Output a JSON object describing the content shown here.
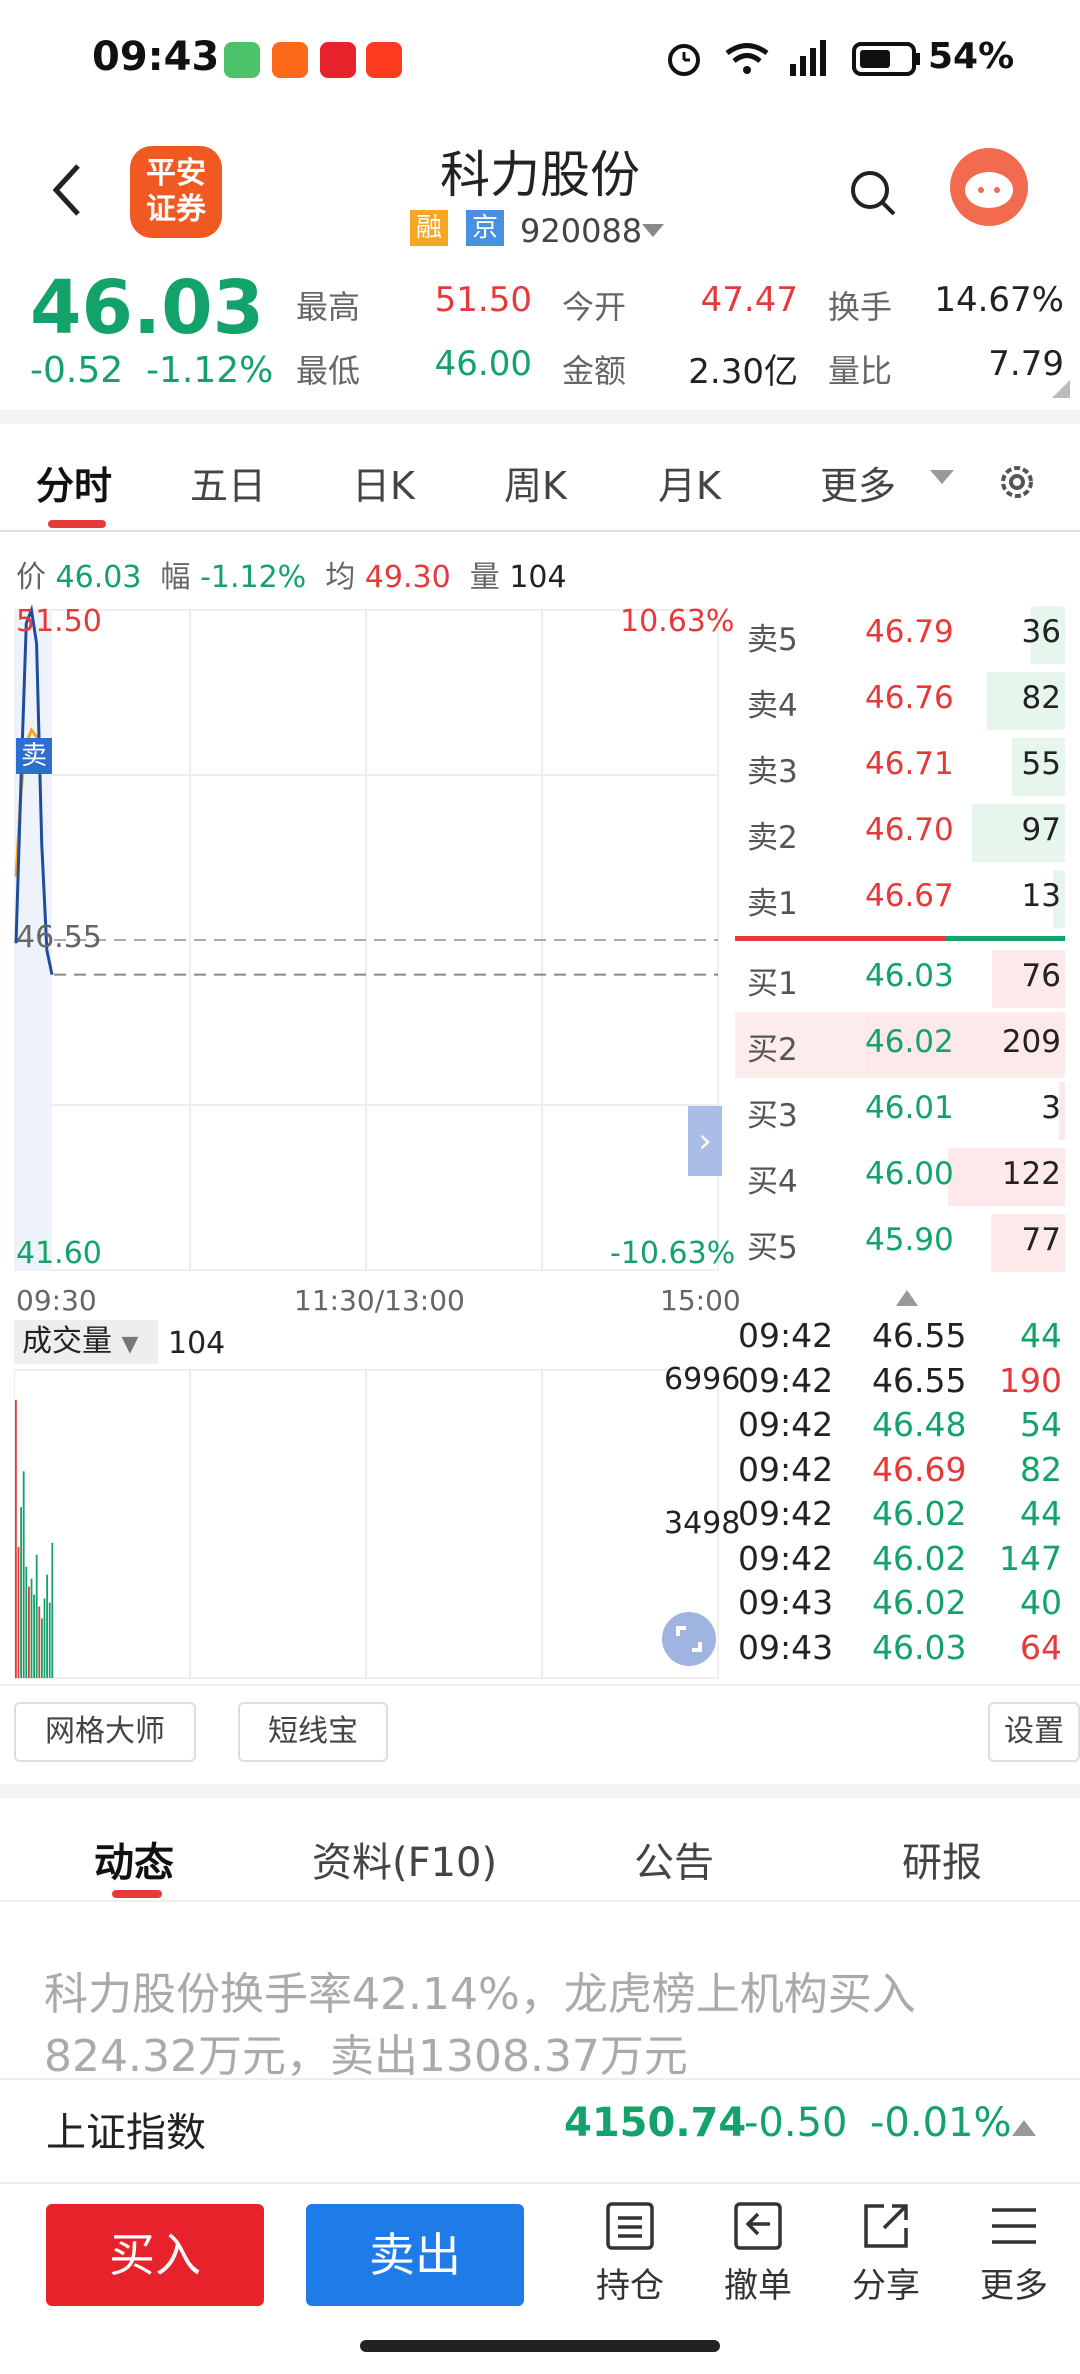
{
  "status_bar": {
    "time": "09:43",
    "battery": "54%"
  },
  "header": {
    "logo_line1": "平安",
    "logo_line2": "证券",
    "stock_name": "科力股份",
    "tag_margin": "融",
    "tag_exchange": "京",
    "stock_code": "920088"
  },
  "quote": {
    "price": "46.03",
    "change": "-0.52",
    "change_pct": "-1.12%",
    "high_label": "最高",
    "high": "51.50",
    "low_label": "最低",
    "low": "46.00",
    "open_label": "今开",
    "open": "47.47",
    "amount_label": "金额",
    "amount": "2.30亿",
    "turnover_label": "换手",
    "turnover": "14.67%",
    "volume_ratio_label": "量比",
    "volume_ratio": "7.79"
  },
  "tabs": [
    "分时",
    "五日",
    "日K",
    "周K",
    "月K",
    "更多"
  ],
  "info_row": {
    "price_label": "价",
    "price": "46.03",
    "range_label": "幅",
    "range": "-1.12%",
    "avg_label": "均",
    "avg": "49.30",
    "vol_label": "量",
    "vol": "104"
  },
  "chart_data": {
    "type": "line",
    "y_left_top": "51.50",
    "y_left_mid": "46.55",
    "y_left_bottom": "41.60",
    "y_right_top": "10.63%",
    "y_right_bottom": "-10.63%",
    "x_labels": [
      "09:30",
      "11:30/13:00",
      "15:00"
    ],
    "ylim": [
      41.6,
      51.5
    ],
    "prev_close": 46.55,
    "price_series": [
      46.5,
      49.0,
      51.3,
      51.5,
      51.0,
      48.0,
      46.4,
      46.03
    ],
    "avg_series": [
      47.5,
      48.8,
      49.5,
      49.7,
      49.6,
      49.4,
      49.3,
      49.3
    ],
    "marker": "卖",
    "volume_label": "成交量",
    "volume_value": "104",
    "volume_axis_top": "6996",
    "volume_axis_mid": "3498",
    "volume_ylim": [
      0,
      6996
    ],
    "volume_bars": [
      {
        "v": 6996,
        "c": "red"
      },
      {
        "v": 3300,
        "c": "red"
      },
      {
        "v": 4300,
        "c": "green"
      },
      {
        "v": 5200,
        "c": "green"
      },
      {
        "v": 2800,
        "c": "green"
      },
      {
        "v": 2300,
        "c": "red"
      },
      {
        "v": 2500,
        "c": "green"
      },
      {
        "v": 2100,
        "c": "green"
      },
      {
        "v": 3100,
        "c": "green"
      },
      {
        "v": 1800,
        "c": "red"
      },
      {
        "v": 1500,
        "c": "green"
      },
      {
        "v": 2000,
        "c": "green"
      },
      {
        "v": 2600,
        "c": "green"
      },
      {
        "v": 1900,
        "c": "green"
      },
      {
        "v": 3400,
        "c": "green"
      }
    ]
  },
  "orderbook": {
    "asks": [
      {
        "label": "卖5",
        "price": "46.79",
        "vol": "36"
      },
      {
        "label": "卖4",
        "price": "46.76",
        "vol": "82"
      },
      {
        "label": "卖3",
        "price": "46.71",
        "vol": "55"
      },
      {
        "label": "卖2",
        "price": "46.70",
        "vol": "97"
      },
      {
        "label": "卖1",
        "price": "46.67",
        "vol": "13"
      }
    ],
    "bids": [
      {
        "label": "买1",
        "price": "46.03",
        "vol": "76"
      },
      {
        "label": "买2",
        "price": "46.02",
        "vol": "209"
      },
      {
        "label": "买3",
        "price": "46.01",
        "vol": "3"
      },
      {
        "label": "买4",
        "price": "46.00",
        "vol": "122"
      },
      {
        "label": "买5",
        "price": "45.90",
        "vol": "77"
      }
    ]
  },
  "trades": [
    {
      "time": "09:42",
      "price": "46.55",
      "vol": "44",
      "pc": "black",
      "vc": "green"
    },
    {
      "time": "09:42",
      "price": "46.55",
      "vol": "190",
      "pc": "black",
      "vc": "red"
    },
    {
      "time": "09:42",
      "price": "46.48",
      "vol": "54",
      "pc": "green",
      "vc": "green"
    },
    {
      "time": "09:42",
      "price": "46.69",
      "vol": "82",
      "pc": "red",
      "vc": "green"
    },
    {
      "time": "09:42",
      "price": "46.02",
      "vol": "44",
      "pc": "green",
      "vc": "green"
    },
    {
      "time": "09:42",
      "price": "46.02",
      "vol": "147",
      "pc": "green",
      "vc": "green"
    },
    {
      "time": "09:43",
      "price": "46.02",
      "vol": "40",
      "pc": "green",
      "vc": "green"
    },
    {
      "time": "09:43",
      "price": "46.03",
      "vol": "64",
      "pc": "green",
      "vc": "red"
    }
  ],
  "tools": {
    "grid_master": "网格大师",
    "short_line": "短线宝",
    "settings": "设置"
  },
  "section_tabs": [
    "动态",
    "资料(F10)",
    "公告",
    "研报"
  ],
  "news": "科力股份换手率42.14%，龙虎榜上机构买入824.32万元，卖出1308.37万元",
  "index": {
    "name": "上证指数",
    "value": "4150.74",
    "change": "-0.50",
    "pct": "-0.01%"
  },
  "bottom_bar": {
    "buy": "买入",
    "sell": "卖出",
    "holdings": "持仓",
    "cancel": "撤单",
    "share": "分享",
    "more": "更多"
  },
  "colors": {
    "up": "#e63a3a",
    "down": "#13a36a",
    "buy_button": "#e8222a",
    "sell_button": "#1e7be8",
    "avg_line": "#f5a623",
    "price_line": "#1f4d9c"
  }
}
